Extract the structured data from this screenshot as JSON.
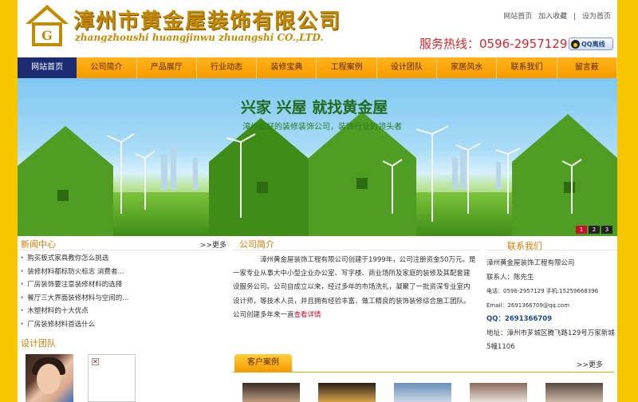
{
  "header": {
    "logo_cn": "漳州市黄金屋装饰有限公司",
    "logo_en": "zhangzhoushi huangjinwu zhuangshi CO.,LTD.",
    "top_links": [
      "网站首页",
      "加入收藏",
      "|",
      "设为首页"
    ],
    "hotline": "服务热线：0596-2957129",
    "qq_badge": "QQ离线"
  },
  "nav": {
    "items": [
      "网站首页",
      "公司简介",
      "产品展厅",
      "行业动态",
      "装修宝典",
      "工程案例",
      "设计团队",
      "家居风水",
      "联系我们",
      "留言薮"
    ],
    "active_index": 0
  },
  "banner": {
    "slogan": "兴家 兴屋 就找黄金屋",
    "sub": "漳州最好的装修装饰公司，装饰行业的领头者",
    "dots": [
      "1",
      "2",
      "3"
    ],
    "active_dot": 0
  },
  "news": {
    "title": "新闻中心",
    "more": ">>更多",
    "items": [
      "购买板式家具教你怎么挑选",
      "装修材料都标防火标志 消费者...",
      "厂房装饰要注意装修材料的选择",
      "餐厅三大界面装修材料与空间的...",
      "木塑材料的十大优点",
      "厂房装修材料首选什么"
    ]
  },
  "team": {
    "title": "设计团队"
  },
  "about": {
    "title": "公司简介",
    "text": "漳州黄金屋装饰工程有限公司创建于1999年，公司注册资金50万元。是一家专业从事大中小型企业办公室、写字楼、商业场所及家庭的装修及其配套建设服务公司。公司自成立以来，经过多年的市场洗礼，凝聚了一批资深专业室内设计师，等技术人员，并且拥有经验丰富、做工精良的装饰装修综合施工团队。        公司创建多年来一直",
    "detail": "查看详情"
  },
  "cases": {
    "title": "客户案例",
    "more": ">>更多"
  },
  "contact": {
    "title": "联系我们",
    "company": "漳州黄金屋装饰工程有限公司",
    "person": "联系人：陈先生",
    "phone": "电话：0596-2957129 手机:15259668396",
    "email": "Email：2691366709@qq.com",
    "qq": "QQ：2691366709",
    "address": "地址：漳州市芗城区腾飞路129号万家新城5幢1106"
  },
  "colors": {
    "accent": "#f59a00",
    "nav_active": "#1d2b73",
    "hotline": "#e0262c",
    "heading": "#e07b00",
    "side_bg": "#f7c600"
  }
}
